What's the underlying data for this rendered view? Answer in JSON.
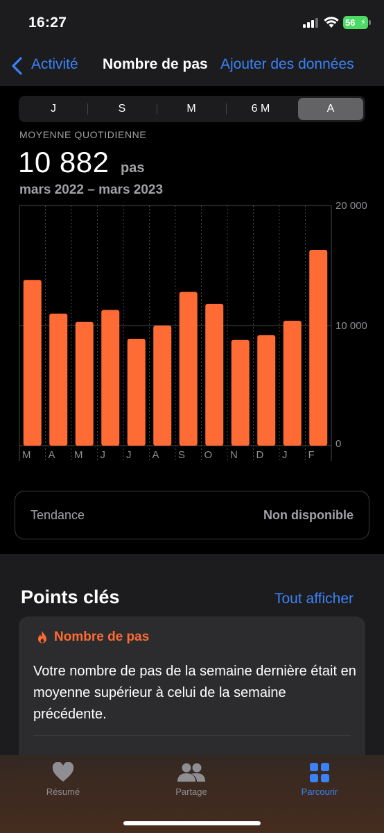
{
  "status_bar": {
    "time": "16:27",
    "battery": "56"
  },
  "nav": {
    "back_label": "Activité",
    "title": "Nombre de pas",
    "add_label": "Ajouter des données"
  },
  "segments": [
    "J",
    "S",
    "M",
    "6 M",
    "A"
  ],
  "selected_segment": "A",
  "stats": {
    "label": "MOYENNE QUOTIDIENNE",
    "value": "10 882",
    "unit": "pas",
    "date_range": "mars 2022 – mars 2023"
  },
  "chart_data": {
    "type": "bar",
    "categories": [
      "M",
      "A",
      "M",
      "J",
      "J",
      "A",
      "S",
      "O",
      "N",
      "D",
      "J",
      "F"
    ],
    "values": [
      13800,
      11000,
      10300,
      11300,
      8900,
      10000,
      12800,
      11800,
      8800,
      9200,
      10400,
      16300
    ],
    "y_ticks": [
      "20 000",
      "10 000",
      "0"
    ],
    "ylim": [
      0,
      20000
    ],
    "bar_color": "#ff6b35",
    "grid": true
  },
  "trend": {
    "label": "Tendance",
    "value": "Non disponible"
  },
  "highlights": {
    "title": "Points clés",
    "link": "Tout afficher",
    "card_title": "Nombre de pas",
    "card_text": "Votre nombre de pas de la semaine dernière était en moyenne supérieur à celui de la semaine précédente."
  },
  "tabs": [
    {
      "label": "Résumé",
      "icon": "heart-icon",
      "active": false
    },
    {
      "label": "Partage",
      "icon": "people-icon",
      "active": false
    },
    {
      "label": "Parcourir",
      "icon": "grid-icon",
      "active": true
    }
  ],
  "colors": {
    "accent": "#3b82f6",
    "orange": "#ff6b35",
    "battery": "#4cd964"
  }
}
